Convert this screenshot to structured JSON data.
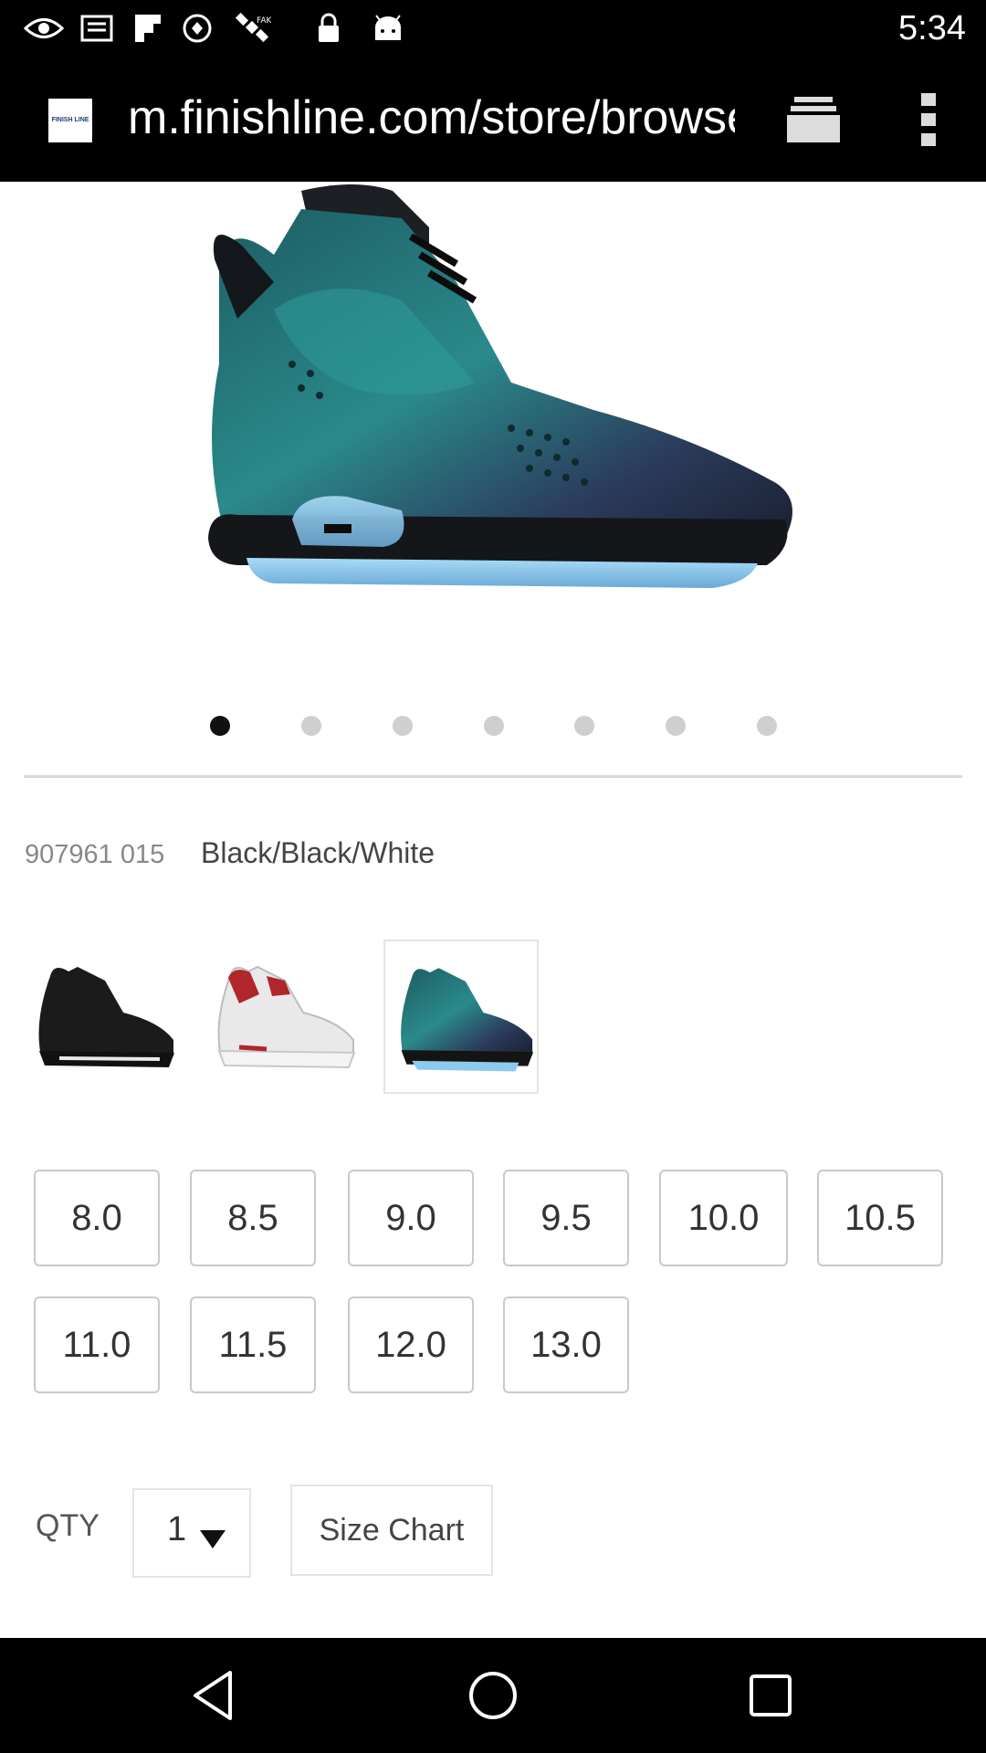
{
  "status_bar": {
    "time": "5:34",
    "icons": [
      "eye-icon",
      "inbox-icon",
      "flipboard-icon",
      "circle-icon",
      "satellite-icon",
      "lock-icon",
      "android-icon"
    ]
  },
  "browser": {
    "favicon_text": "FINISH LINE",
    "url": "m.finishline.com/store/browse",
    "tabs_icon": "tabs-icon",
    "menu_icon": "overflow-menu-icon"
  },
  "product": {
    "carousel": {
      "total": 7,
      "active_index": 0
    },
    "sku": "907961 015",
    "colorway": "Black/Black/White",
    "color_options": [
      {
        "name": "black-sneaker",
        "selected": false
      },
      {
        "name": "white-red-sneaker",
        "selected": false
      },
      {
        "name": "teal-chameleon-sneaker",
        "selected": true
      }
    ],
    "sizes_row1": [
      "8.0",
      "8.5",
      "9.0",
      "9.5",
      "10.0",
      "10.5"
    ],
    "sizes_row2": [
      "11.0",
      "11.5",
      "12.0",
      "13.0"
    ],
    "qty_label": "QTY",
    "qty_value": "1",
    "size_chart_label": "Size Chart"
  },
  "nav": {
    "buttons": [
      "back-icon",
      "home-icon",
      "recents-icon"
    ]
  },
  "colors": {
    "bar_bg": "#000000",
    "accent_teal": "#1f6a6e",
    "sole_blue": "#8ec9ee",
    "border": "#c9c9c9"
  }
}
